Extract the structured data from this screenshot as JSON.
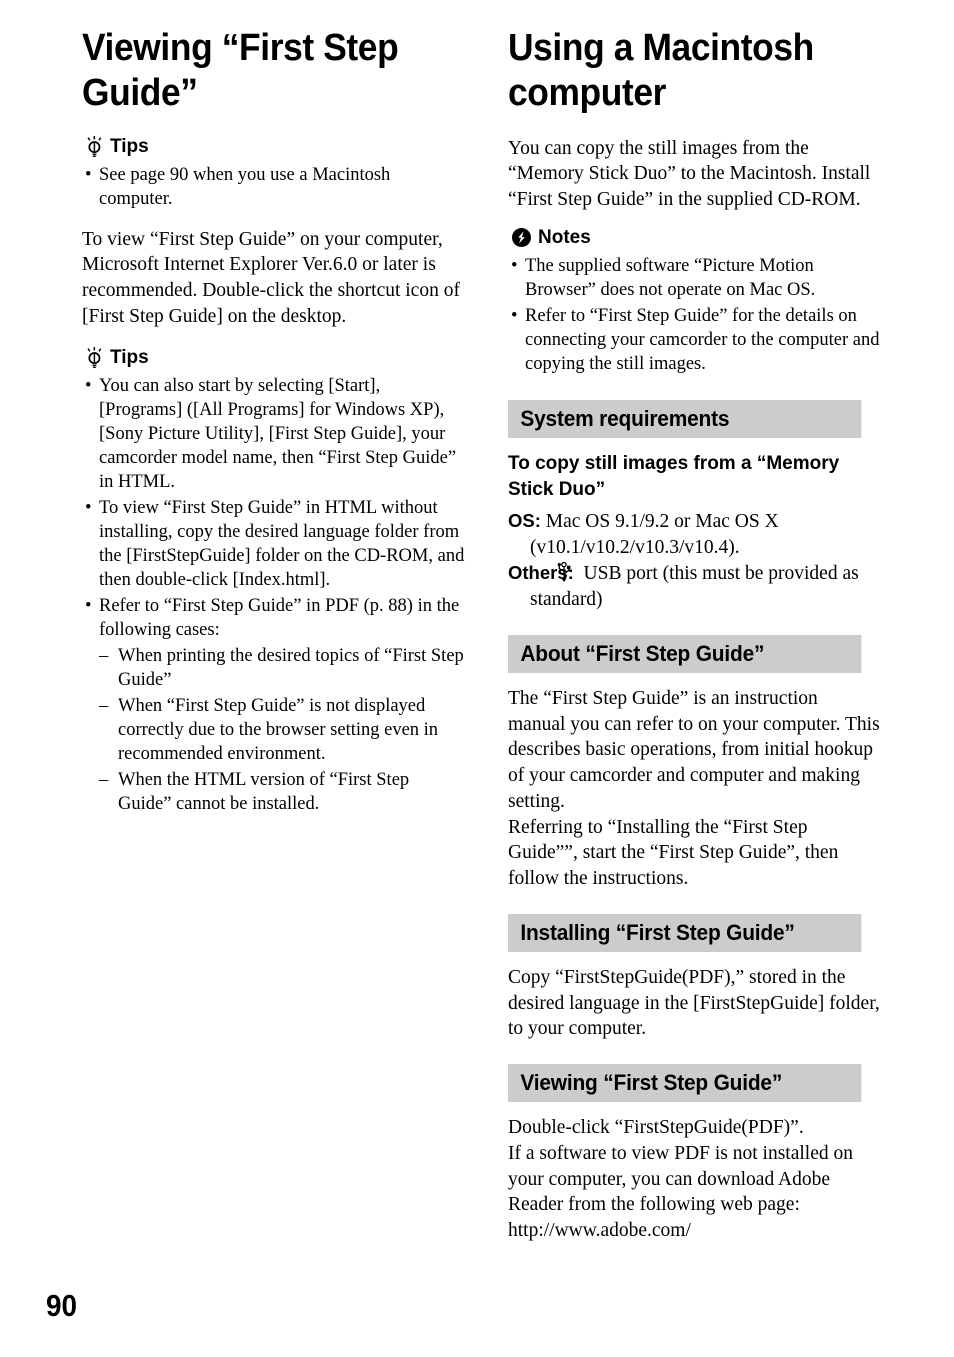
{
  "page": {
    "number": "90",
    "banner_color": "#cccccc"
  },
  "left_column": {
    "title": "Viewing “First Step\nGuide”",
    "tips1": {
      "icon": "lightbulb-icon",
      "label": "Tips",
      "items": [
        "See page 90 when you use a Macintosh computer."
      ]
    },
    "paragraph": "To view “First Step Guide” on your computer, Microsoft Internet Explorer Ver.6.0 or later is recommended. Double-click the shortcut icon of [First Step Guide] on the desktop.",
    "tips2": {
      "icon": "lightbulb-icon",
      "label": "Tips",
      "items": [
        "You can also start by selecting [Start], [Programs] ([All Programs] for Windows XP), [Sony Picture Utility], [First Step Guide], your camcorder model name, then “First Step Guide” in HTML.",
        "To view “First Step Guide” in HTML without installing, copy the desired language folder from the [FirstStepGuide] folder on the CD-ROM, and then double-click [Index.html].",
        "Refer to “First Step Guide” in PDF (p. 88) in the following cases:"
      ],
      "sub_items": [
        "When printing the desired topics of “First Step Guide”",
        "When “First Step Guide” is not displayed correctly due to the browser setting even in recommended environment.",
        "When the HTML version of “First Step Guide” cannot be installed."
      ]
    }
  },
  "right_column": {
    "title": "Using a Macintosh\ncomputer",
    "intro": "You can copy the still images from the “Memory Stick Duo” to the Macintosh. Install “First Step Guide” in the supplied CD-ROM.",
    "notes": {
      "icon": "notes-exclamation-icon",
      "label": "Notes",
      "items": [
        "The supplied software “Picture Motion Browser” does not operate on Mac OS.",
        "Refer to “First Step Guide” for the details on connecting your camcorder to the computer and copying the still images."
      ]
    },
    "sections": [
      {
        "band": "System requirements",
        "subheading": "To copy still images from a “Memory Stick Duo”",
        "definitions": [
          {
            "term": "OS:",
            "value": "Mac OS 9.1/9.2 or Mac OS X (v10.1/v10.2/v10.3/v10.4)."
          },
          {
            "term": "Others:",
            "icon": "usb-icon",
            "value": "USB port (this must be provided as standard)"
          }
        ]
      },
      {
        "band": "About “First Step Guide”",
        "paragraphs": [
          "The “First Step Guide” is an instruction manual you can refer to on your computer. This describes basic operations, from initial hookup of your camcorder and computer and making setting.",
          "Referring to “Installing the “First Step Guide””, start the “First Step Guide”, then follow the instructions."
        ]
      },
      {
        "band": "Installing “First Step Guide”",
        "paragraphs": [
          "Copy “FirstStepGuide(PDF),” stored in the desired language in the [FirstStepGuide] folder, to your computer."
        ]
      },
      {
        "band": "Viewing “First Step Guide”",
        "paragraphs": [
          "Double-click “FirstStepGuide(PDF)”.",
          "If a software to view PDF is not installed on your computer, you can download Adobe Reader from the following web page:",
          "http://www.adobe.com/"
        ]
      }
    ]
  }
}
